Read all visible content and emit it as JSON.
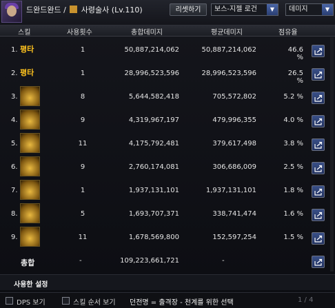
{
  "header": {
    "title_left": "드완드완드 / ",
    "title_right": " 사령술사 (Lv.110)",
    "reset_button": "리셋하기",
    "boss_select": "보스-지젤 로건",
    "mode_select": "데미지"
  },
  "columns": {
    "skill": "스킬",
    "count": "사용횟수",
    "total": "총합데미지",
    "avg": "평균데미지",
    "share": "점유율"
  },
  "rows": [
    {
      "num": "1.",
      "skill_label": "평타",
      "icon": "basic-attack-text",
      "count": "1",
      "total": "50,887,214,062",
      "avg": "50,887,214,062",
      "share": "46.6 %"
    },
    {
      "num": "2.",
      "skill_label": "평타",
      "icon": "basic-attack-text",
      "count": "1",
      "total": "28,996,523,596",
      "avg": "28,996,523,596",
      "share": "26.5 %"
    },
    {
      "num": "3.",
      "skill_label": "",
      "icon": "beast-claw-icon",
      "count": "8",
      "total": "5,644,582,418",
      "avg": "705,572,802",
      "share": "5.2 %"
    },
    {
      "num": "4.",
      "skill_label": "",
      "icon": "summon-beast-icon",
      "count": "9",
      "total": "4,319,967,197",
      "avg": "479,996,355",
      "share": "4.0 %"
    },
    {
      "num": "5.",
      "skill_label": "",
      "icon": "wolf-howl-icon",
      "count": "11",
      "total": "4,175,792,481",
      "avg": "379,617,498",
      "share": "3.8 %"
    },
    {
      "num": "6.",
      "skill_label": "",
      "icon": "slash-icon",
      "count": "9",
      "total": "2,760,174,081",
      "avg": "306,686,009",
      "share": "2.5 %"
    },
    {
      "num": "7.",
      "skill_label": "",
      "icon": "beast-rush-icon",
      "count": "1",
      "total": "1,937,131,101",
      "avg": "1,937,131,101",
      "share": "1.8 %"
    },
    {
      "num": "8.",
      "skill_label": "",
      "icon": "dash-strike-icon",
      "count": "5",
      "total": "1,693,707,371",
      "avg": "338,741,474",
      "share": "1.6 %"
    },
    {
      "num": "9.",
      "skill_label": "",
      "icon": "claw-burst-icon",
      "count": "11",
      "total": "1,678,569,800",
      "avg": "152,597,254",
      "share": "1.5 %"
    }
  ],
  "summary": {
    "label": "총합",
    "count": "-",
    "total": "109,223,661,721",
    "avg": "-"
  },
  "settings_tab": "사용한 설정",
  "footer": {
    "dps_label": "DPS 보기",
    "skill_order_label": "스킬 순서 보기",
    "dungeon_text": "던전명 = 출격장 - 천계를 위한 선택",
    "page": "1 / 4"
  },
  "colors": {
    "accent_gold": "#ffc31e",
    "share_button": "#2a3e72"
  }
}
